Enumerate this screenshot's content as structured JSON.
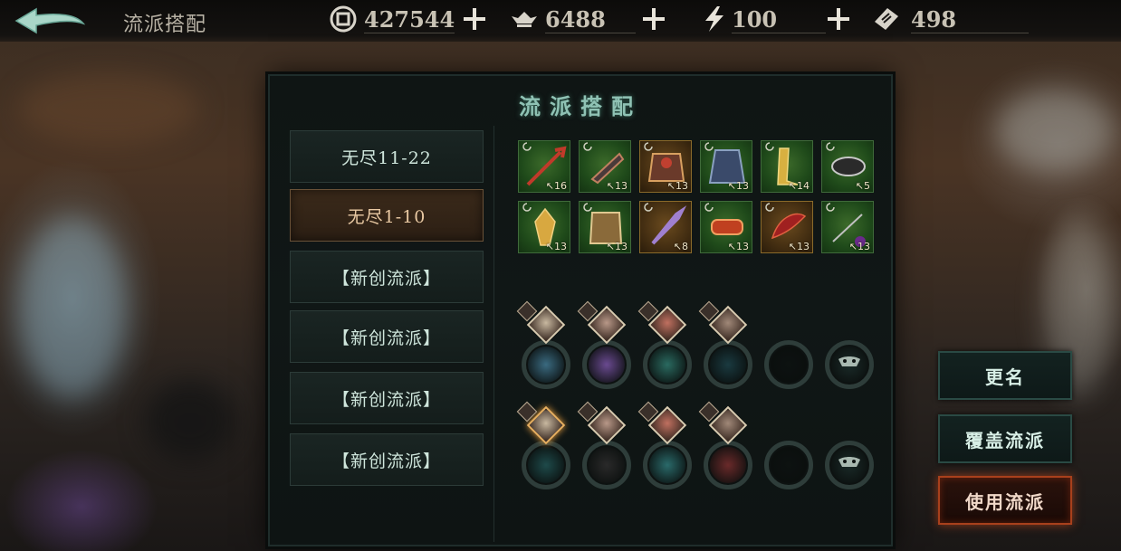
{
  "header": {
    "title": "流派搭配",
    "back_icon": "back-arrow-icon",
    "resources": [
      {
        "name": "coin",
        "icon": "coin-icon",
        "value": "427544"
      },
      {
        "name": "ingot",
        "icon": "ingot-icon",
        "value": "6488"
      },
      {
        "name": "stamina",
        "icon": "lightning-icon",
        "value": "100"
      },
      {
        "name": "ticket",
        "icon": "ticket-icon",
        "value": "498"
      }
    ]
  },
  "panel": {
    "title": "流派搭配",
    "builds": [
      {
        "label": "无尽11-22",
        "active": false
      },
      {
        "label": "无尽1-10",
        "active": true
      },
      {
        "label": "【新创流派】",
        "active": false
      },
      {
        "label": "【新创流派】",
        "active": false
      },
      {
        "label": "【新创流派】",
        "active": false
      },
      {
        "label": "【新创流派】",
        "active": false
      }
    ],
    "equipment": [
      {
        "icon": "spear-icon",
        "level": "16",
        "rarity": "green"
      },
      {
        "icon": "gauntlet-icon",
        "level": "13",
        "rarity": "green"
      },
      {
        "icon": "armor-icon",
        "level": "13",
        "rarity": "gold"
      },
      {
        "icon": "robe-icon",
        "level": "13",
        "rarity": "green"
      },
      {
        "icon": "boots-icon",
        "level": "14",
        "rarity": "green"
      },
      {
        "icon": "hat-icon",
        "level": "5",
        "rarity": "green"
      },
      {
        "icon": "charm-icon",
        "level": "13",
        "rarity": "green"
      },
      {
        "icon": "cloak-icon",
        "level": "13",
        "rarity": "green"
      },
      {
        "icon": "staff-icon",
        "level": "8",
        "rarity": "gold"
      },
      {
        "icon": "bracelet-icon",
        "level": "13",
        "rarity": "green"
      },
      {
        "icon": "blade-icon",
        "level": "13",
        "rarity": "gold"
      },
      {
        "icon": "dual-item-icon",
        "level": "13",
        "rarity": "green"
      }
    ]
  },
  "actions": {
    "rename": "更名",
    "overwrite": "覆盖流派",
    "use": "使用流派"
  },
  "colors": {
    "accent_teal": "#8fc2b4",
    "active_build": "#3b2a1a",
    "primary_button_border": "#a8401c",
    "equip_green": "#3c6a2a",
    "equip_gold": "#6a4a1e"
  }
}
